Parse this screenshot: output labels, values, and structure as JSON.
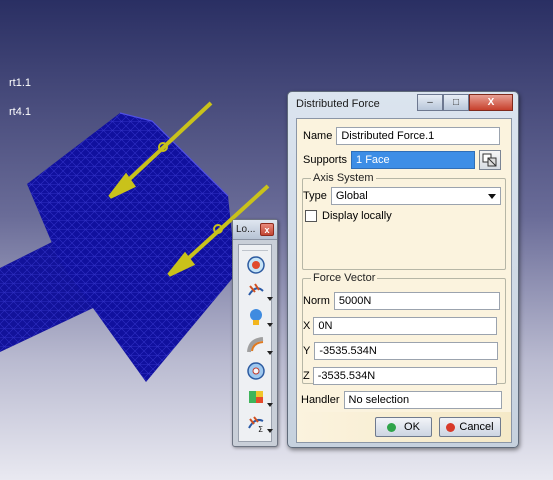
{
  "tree": {
    "labels": [
      "rt1.1",
      "rt4.1"
    ]
  },
  "toolbar": {
    "title": "Lo...",
    "close_label": "x",
    "buttons": [
      {
        "icon": "load-target-icon"
      },
      {
        "icon": "distributed-force-icon"
      },
      {
        "icon": "pressure-icon"
      },
      {
        "icon": "bearing-load-icon"
      },
      {
        "icon": "moment-icon"
      },
      {
        "icon": "acceleration-icon"
      },
      {
        "icon": "force-density-icon"
      }
    ]
  },
  "dialog": {
    "title": "Distributed Force",
    "window_buttons": {
      "minimize": "–",
      "maximize": "□",
      "close": "X"
    },
    "name_label": "Name",
    "name_value": "Distributed Force.1",
    "supports_label": "Supports",
    "supports_value": "1 Face",
    "axis_group_label": "Axis System",
    "type_label": "Type",
    "type_value": "Global",
    "display_locally_label": "Display locally",
    "display_locally_checked": false,
    "force_group_label": "Force Vector",
    "norm_label": "Norm",
    "norm_value": "5000N",
    "x_label": "X",
    "x_value": "0N",
    "y_label": "Y",
    "y_value": "-3535.534N",
    "z_label": "Z",
    "z_value": "-3535.534N",
    "handler_label": "Handler",
    "handler_value": "No selection",
    "ok_label": "OK",
    "cancel_label": "Cancel"
  },
  "colors": {
    "part": "#1a1aa6",
    "arrow": "#c8c81e",
    "selection": "#3d8ee6",
    "panel": "#fbf3de"
  }
}
